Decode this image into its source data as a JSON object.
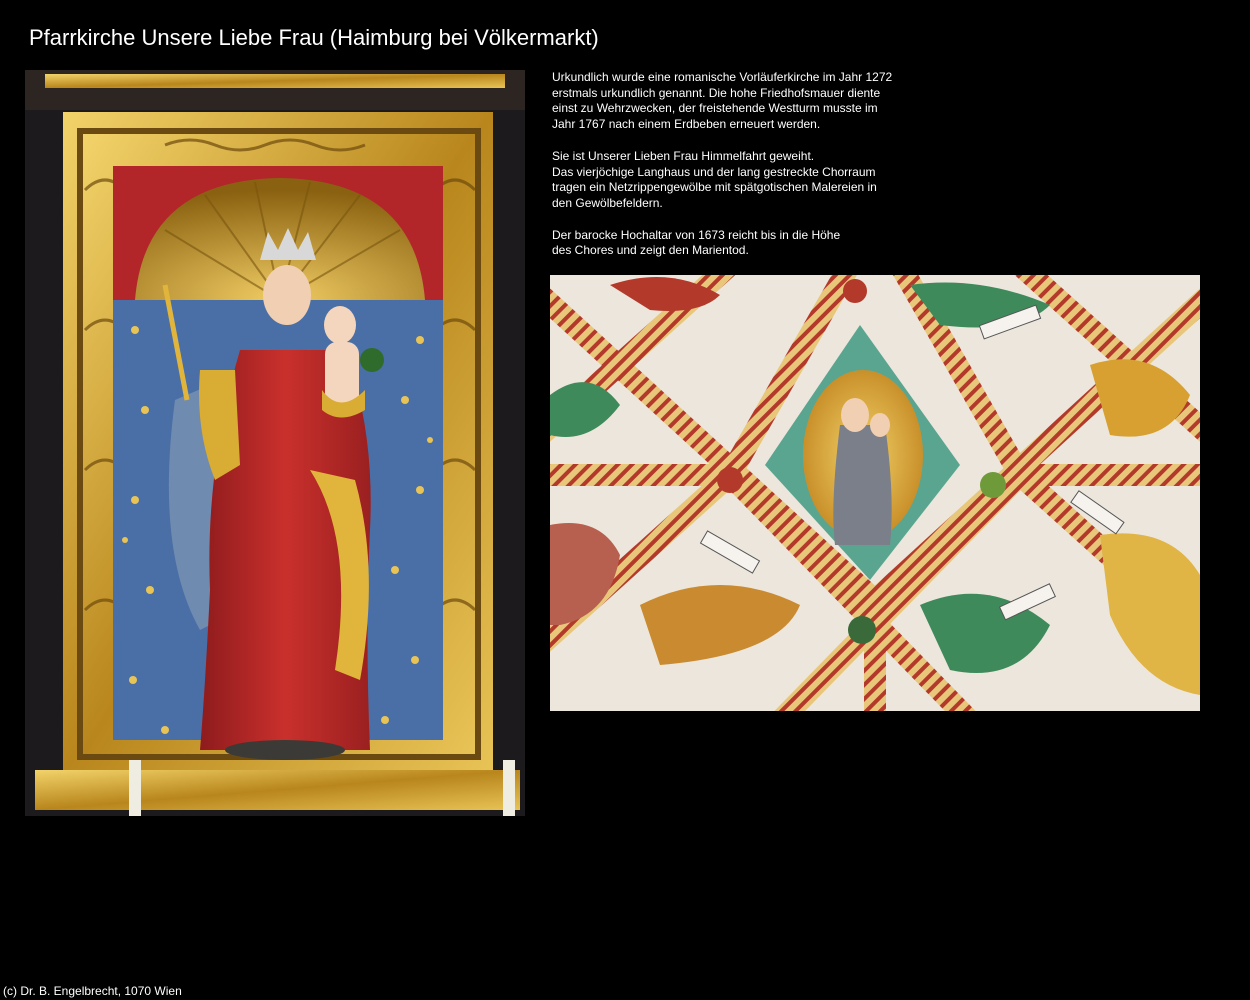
{
  "title": "Pfarrkirche Unsere Liebe Frau (Haimburg bei Völkermarkt)",
  "description": {
    "paragraph_1": [
      "Urkundlich wurde eine romanische Vorläuferkirche im Jahr 1272",
      "erstmals urkundlich genannt. Die hohe Friedhofsmauer diente",
      "einst zu Wehrzwecken, der freistehende Westturm musste im",
      "Jahr 1767 nach einem Erdbeben erneuert werden."
    ],
    "paragraph_2": [
      "Sie ist Unserer Lieben Frau Himmelfahrt geweiht.",
      "Das vierjöchige Langhaus und der lang gestreckte Chorraum",
      "tragen ein Netzrippengewölbe mit spätgotischen Malereien in",
      "den Gewölbefeldern."
    ],
    "paragraph_3": [
      "Der barocke Hochaltar von 1673 reicht bis in die Höhe",
      "des Chores und zeigt den Marientod."
    ]
  },
  "footer": "(c) Dr. B. Engelbrecht, 1070 Wien",
  "colors": {
    "background": "#000000",
    "text": "#ffffff",
    "gold": "#c9a02a",
    "altar_red": "#b2262a",
    "niche_blue": "#4a6fa6",
    "vault_white": "#ece6dc"
  }
}
